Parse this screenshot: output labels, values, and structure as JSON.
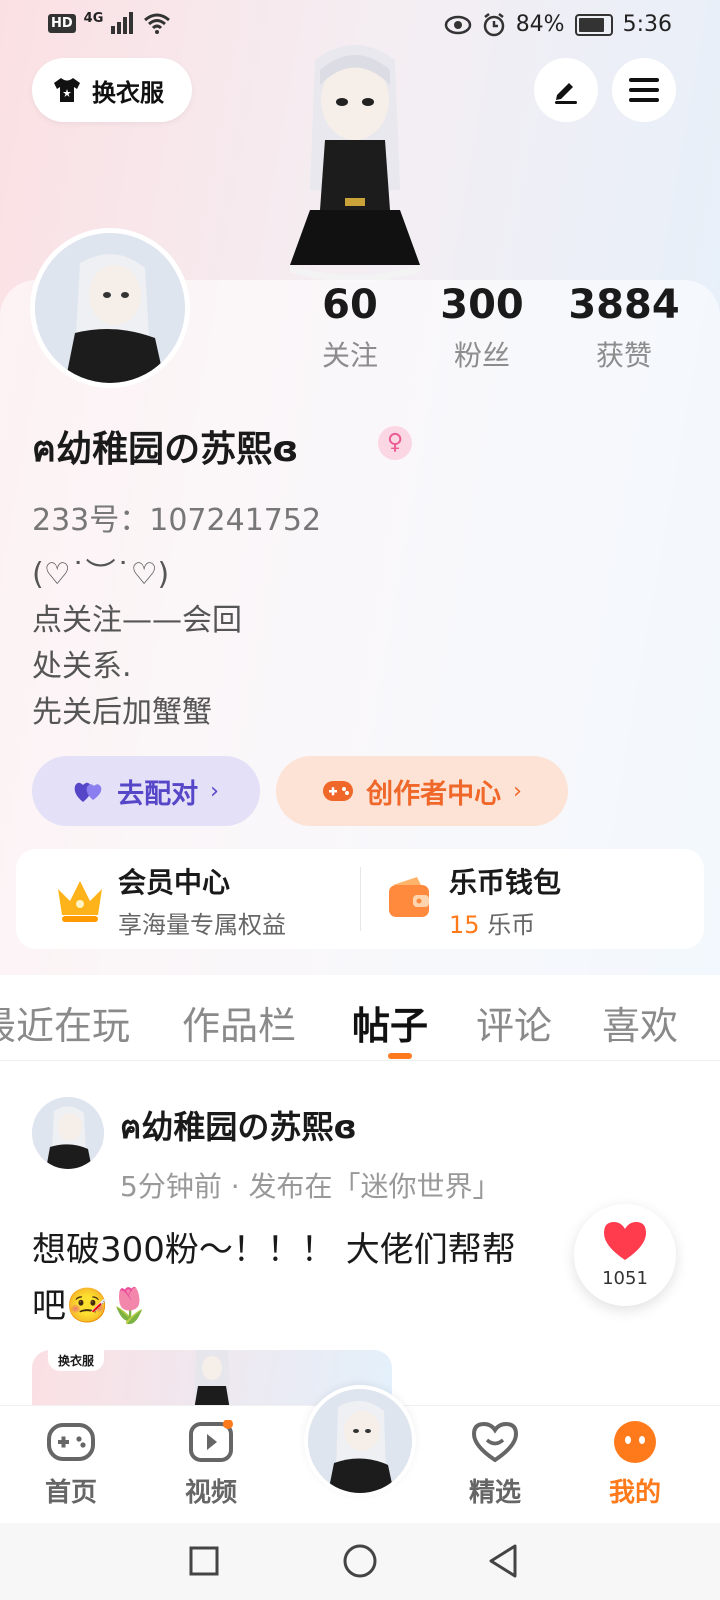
{
  "status_bar": {
    "hd": "HD",
    "network": "4G",
    "battery": "84%",
    "battery_level": 0.84,
    "time": "5:36"
  },
  "top_bar": {
    "dress_label": "换衣服",
    "edit_icon": "pen-icon",
    "menu_icon": "menu-icon"
  },
  "profile": {
    "nickname": "ฅ幼稚园の苏熙ɞ",
    "gender": "♀",
    "uid": "233号：107241752",
    "bio": "(♡˙︶˙♡)\n点关注——会回\n处关系.\n先关后加蟹蟹",
    "stats": [
      {
        "value": "60",
        "label": "关注"
      },
      {
        "value": "300",
        "label": "粉丝"
      },
      {
        "value": "3884",
        "label": "获赞"
      }
    ],
    "match_label": "去配对",
    "creator_label": "创作者中心"
  },
  "vip": {
    "title": "会员中心",
    "subtitle": "享海量专属权益"
  },
  "wallet": {
    "title": "乐币钱包",
    "amount": "15",
    "unit": "乐币"
  },
  "tabs": [
    {
      "label": "最近在玩"
    },
    {
      "label": "作品栏"
    },
    {
      "label": "帖子"
    },
    {
      "label": "评论"
    },
    {
      "label": "喜欢"
    }
  ],
  "post": {
    "author": "ฅ幼稚园の苏熙ɞ",
    "meta": "5分钟前 · 发布在「迷你世界」",
    "text": "想破300粉～！！！ 大佬们帮帮",
    "text_line2": "吧🤒🌷",
    "thumb_label": "换衣服",
    "likes": "1051"
  },
  "bottom_nav": [
    {
      "label": "首页",
      "icon": "gamepad-icon"
    },
    {
      "label": "视频",
      "icon": "video-icon"
    },
    {
      "label": "精选",
      "icon": "heart-chat-icon"
    },
    {
      "label": "我的",
      "icon": "profile-face-icon"
    }
  ],
  "colors": {
    "accent": "#ff7a1a",
    "match": "#5647c9",
    "creator": "#f0672a"
  }
}
